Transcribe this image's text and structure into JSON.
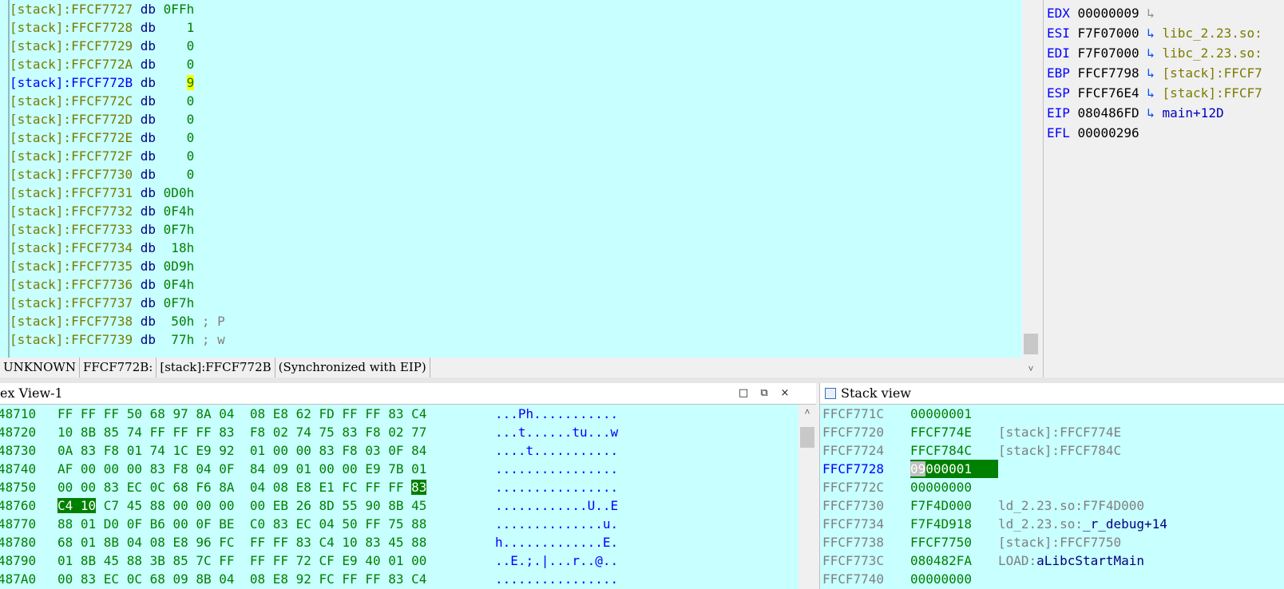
{
  "ida_view": {
    "lines": [
      {
        "seg": "[stack]:FFCF7727",
        "op": "db",
        "val": "0FFh",
        "cmt": ""
      },
      {
        "seg": "[stack]:FFCF7728",
        "op": "db",
        "val": "   1",
        "cmt": ""
      },
      {
        "seg": "[stack]:FFCF7729",
        "op": "db",
        "val": "   0",
        "cmt": ""
      },
      {
        "seg": "[stack]:FFCF772A",
        "op": "db",
        "val": "   0",
        "cmt": ""
      },
      {
        "seg": "[stack]:FFCF772B",
        "op": "db",
        "val": "   9",
        "cmt": "",
        "selected": true
      },
      {
        "seg": "[stack]:FFCF772C",
        "op": "db",
        "val": "   0",
        "cmt": ""
      },
      {
        "seg": "[stack]:FFCF772D",
        "op": "db",
        "val": "   0",
        "cmt": ""
      },
      {
        "seg": "[stack]:FFCF772E",
        "op": "db",
        "val": "   0",
        "cmt": ""
      },
      {
        "seg": "[stack]:FFCF772F",
        "op": "db",
        "val": "   0",
        "cmt": ""
      },
      {
        "seg": "[stack]:FFCF7730",
        "op": "db",
        "val": "   0",
        "cmt": ""
      },
      {
        "seg": "[stack]:FFCF7731",
        "op": "db",
        "val": "0D0h",
        "cmt": ""
      },
      {
        "seg": "[stack]:FFCF7732",
        "op": "db",
        "val": "0F4h",
        "cmt": ""
      },
      {
        "seg": "[stack]:FFCF7733",
        "op": "db",
        "val": "0F7h",
        "cmt": ""
      },
      {
        "seg": "[stack]:FFCF7734",
        "op": "db",
        "val": " 18h",
        "cmt": ""
      },
      {
        "seg": "[stack]:FFCF7735",
        "op": "db",
        "val": "0D9h",
        "cmt": ""
      },
      {
        "seg": "[stack]:FFCF7736",
        "op": "db",
        "val": "0F4h",
        "cmt": ""
      },
      {
        "seg": "[stack]:FFCF7737",
        "op": "db",
        "val": "0F7h",
        "cmt": ""
      },
      {
        "seg": "[stack]:FFCF7738",
        "op": "db",
        "val": " 50h",
        "cmt": "; P"
      },
      {
        "seg": "[stack]:FFCF7739",
        "op": "db",
        "val": " 77h",
        "cmt": "; w"
      }
    ],
    "status": {
      "type": "UNKNOWN",
      "addr": "FFCF772B:",
      "location": "[stack]:FFCF772B",
      "sync": "(Synchronized with EIP)"
    }
  },
  "registers": [
    {
      "name": "EDX",
      "value": "00000009",
      "arrow": "↳",
      "target": ""
    },
    {
      "name": "ESI",
      "value": "F7F07000",
      "arrow": "↳",
      "target": "libc_2.23.so:"
    },
    {
      "name": "EDI",
      "value": "F7F07000",
      "arrow": "↳",
      "target": "libc_2.23.so:"
    },
    {
      "name": "EBP",
      "value": "FFCF7798",
      "arrow": "↳",
      "target": "[stack]:FFCF7"
    },
    {
      "name": "ESP",
      "value": "FFCF76E4",
      "arrow": "↳",
      "target": "[stack]:FFCF7"
    },
    {
      "name": "EIP",
      "value": "080486FD",
      "arrow": "↳",
      "target": "main+12D"
    },
    {
      "name": "EFL",
      "value": "00000296",
      "arrow": "",
      "target": ""
    }
  ],
  "hex_view": {
    "title": "ex View-1",
    "restore_icon": "□",
    "float_icon": "⧉",
    "close_icon": "×",
    "rows": [
      {
        "addr": "48710",
        "bytes": "FF FF FF 50 68 97 8A 04  08 E8 62 FD FF FF 83 C4",
        "ascii": "...Ph..........."
      },
      {
        "addr": "48720",
        "bytes": "10 8B 85 74 FF FF FF 83  F8 02 74 75 83 F8 02 77",
        "ascii": "...t......tu...w"
      },
      {
        "addr": "48730",
        "bytes": "0A 83 F8 01 74 1C E9 92  01 00 00 83 F8 03 0F 84",
        "ascii": "....t..........."
      },
      {
        "addr": "48740",
        "bytes": "AF 00 00 00 83 F8 04 0F  84 09 01 00 00 E9 7B 01",
        "ascii": "................"
      },
      {
        "addr": "48750",
        "bytes": "00 00 83 EC 0C 68 F6 8A  04 08 E8 E1 FC FF FF 83",
        "ascii": "................"
      },
      {
        "addr": "48760",
        "bytes": "C4 10 C7 45 88 00 00 00  00 EB 26 8D 55 90 8B 45",
        "ascii": "............U..E"
      },
      {
        "addr": "48770",
        "bytes": "88 01 D0 0F B6 00 0F BE  C0 83 EC 04 50 FF 75 88",
        "ascii": "..............u."
      },
      {
        "addr": "48780",
        "bytes": "68 01 8B 04 08 E8 96 FC  FF FF 83 C4 10 83 45 88",
        "ascii": "h.............E."
      },
      {
        "addr": "48790",
        "bytes": "01 8B 45 88 3B 85 7C FF  FF FF 72 CF E9 40 01 00",
        "ascii": "..E.;.|...r..@.."
      },
      {
        "addr": "487A0",
        "bytes": "00 83 EC 0C 68 09 8B 04  08 E8 92 FC FF FF 83 C4",
        "ascii": "................"
      }
    ]
  },
  "stack_view": {
    "title": "Stack view",
    "rows": [
      {
        "addr": "FFCF771C",
        "value": "00000001",
        "comment": "",
        "prefix": ""
      },
      {
        "addr": "FFCF7720",
        "value": "FFCF774E",
        "comment": "[stack]:FFCF774E",
        "prefix": ""
      },
      {
        "addr": "FFCF7724",
        "value": "FFCF784C",
        "comment": "[stack]:FFCF784C",
        "prefix": ""
      },
      {
        "addr": "FFCF7728",
        "value": "09000001",
        "comment": "",
        "prefix": "",
        "current": true
      },
      {
        "addr": "FFCF772C",
        "value": "00000000",
        "comment": "",
        "prefix": ""
      },
      {
        "addr": "FFCF7730",
        "value": "F7F4D000",
        "comment": "ld_2.23.so:F7F4D000",
        "prefix": ""
      },
      {
        "addr": "FFCF7734",
        "value": "F7F4D918",
        "comment": "_r_debug+14",
        "prefix": "ld_2.23.so:"
      },
      {
        "addr": "FFCF7738",
        "value": "FFCF7750",
        "comment": "[stack]:FFCF7750",
        "prefix": ""
      },
      {
        "addr": "FFCF773C",
        "value": "080482FA",
        "comment": "aLibcStartMain",
        "prefix": "LOAD:"
      },
      {
        "addr": "FFCF7740",
        "value": "00000000",
        "comment": "",
        "prefix": ""
      }
    ]
  },
  "scroll_arrow_down": "˅",
  "scroll_arrow_up": "˄"
}
